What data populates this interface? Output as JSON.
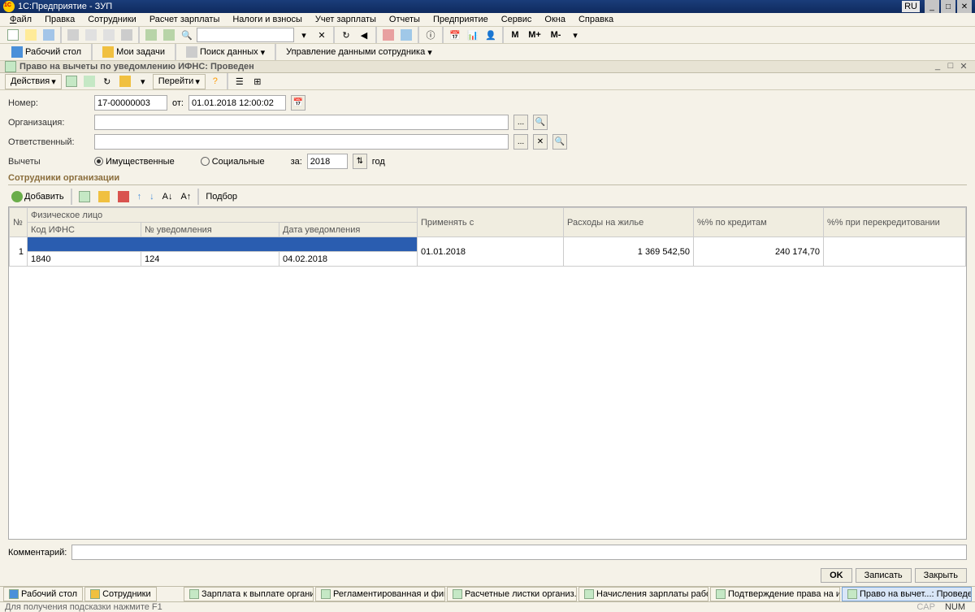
{
  "titlebar": {
    "title": "1С:Предприятие - ЗУП",
    "lang": "RU"
  },
  "menu": [
    "Файл",
    "Правка",
    "Сотрудники",
    "Расчет зарплаты",
    "Налоги и взносы",
    "Учет зарплаты",
    "Отчеты",
    "Предприятие",
    "Сервис",
    "Окна",
    "Справка"
  ],
  "nav_tabs": {
    "desktop": "Рабочий стол",
    "tasks": "Мои задачи",
    "search": "Поиск данных",
    "employee_data": "Управление данными сотрудника"
  },
  "doc": {
    "title": "Право на вычеты по уведомлению ИФНС: Проведен",
    "actions_label": "Действия",
    "goto_label": "Перейти"
  },
  "form": {
    "number_label": "Номер:",
    "number_value": "17-00000003",
    "from_label": "от:",
    "date_value": "01.01.2018 12:00:02",
    "org_label": "Организация:",
    "org_value": "",
    "responsible_label": "Ответственный:",
    "responsible_value": "",
    "deductions_label": "Вычеты",
    "radio_property": "Имущественные",
    "radio_social": "Социальные",
    "for_label": "за:",
    "year_value": "2018",
    "year_label": "год"
  },
  "section": {
    "employees": "Сотрудники организации"
  },
  "grid_toolbar": {
    "add": "Добавить",
    "select": "Подбор"
  },
  "grid": {
    "headers": {
      "num": "№",
      "person": "Физическое лицо",
      "apply_from": "Применять с",
      "housing": "Расходы на жилье",
      "credit_pct": "%% по кредитам",
      "recredit_pct": "%% при перекредитовании",
      "ifns_code": "Код ИФНС",
      "notif_num": "№ уведомления",
      "notif_date": "Дата уведомления"
    },
    "row1": {
      "num": "1",
      "person": "",
      "apply_from": "01.01.2018",
      "housing": "1 369 542,50",
      "credit_pct": "240 174,70",
      "recredit_pct": ""
    },
    "row2": {
      "ifns": "1840",
      "notif_num": "124",
      "notif_date": "04.02.2018"
    }
  },
  "comment_label": "Комментарий:",
  "footer": {
    "ok": "OK",
    "save": "Записать",
    "close": "Закрыть"
  },
  "taskbar": {
    "t1": "Рабочий стол",
    "t2": "Сотрудники",
    "t3": "Зарплата к выплате органи...",
    "t4": "Регламентированная и фин...",
    "t5": "Расчетные листки организ...",
    "t6": "Начисления зарплаты рабо...",
    "t7": "Подтверждение права на и...",
    "t8": "Право на вычет...: Проведен"
  },
  "statusbar": {
    "hint": "Для получения подсказки нажмите F1",
    "cap": "CAP",
    "num": "NUM"
  },
  "toolbar_m": {
    "m": "M",
    "mplus": "M+",
    "mminus": "M-"
  }
}
